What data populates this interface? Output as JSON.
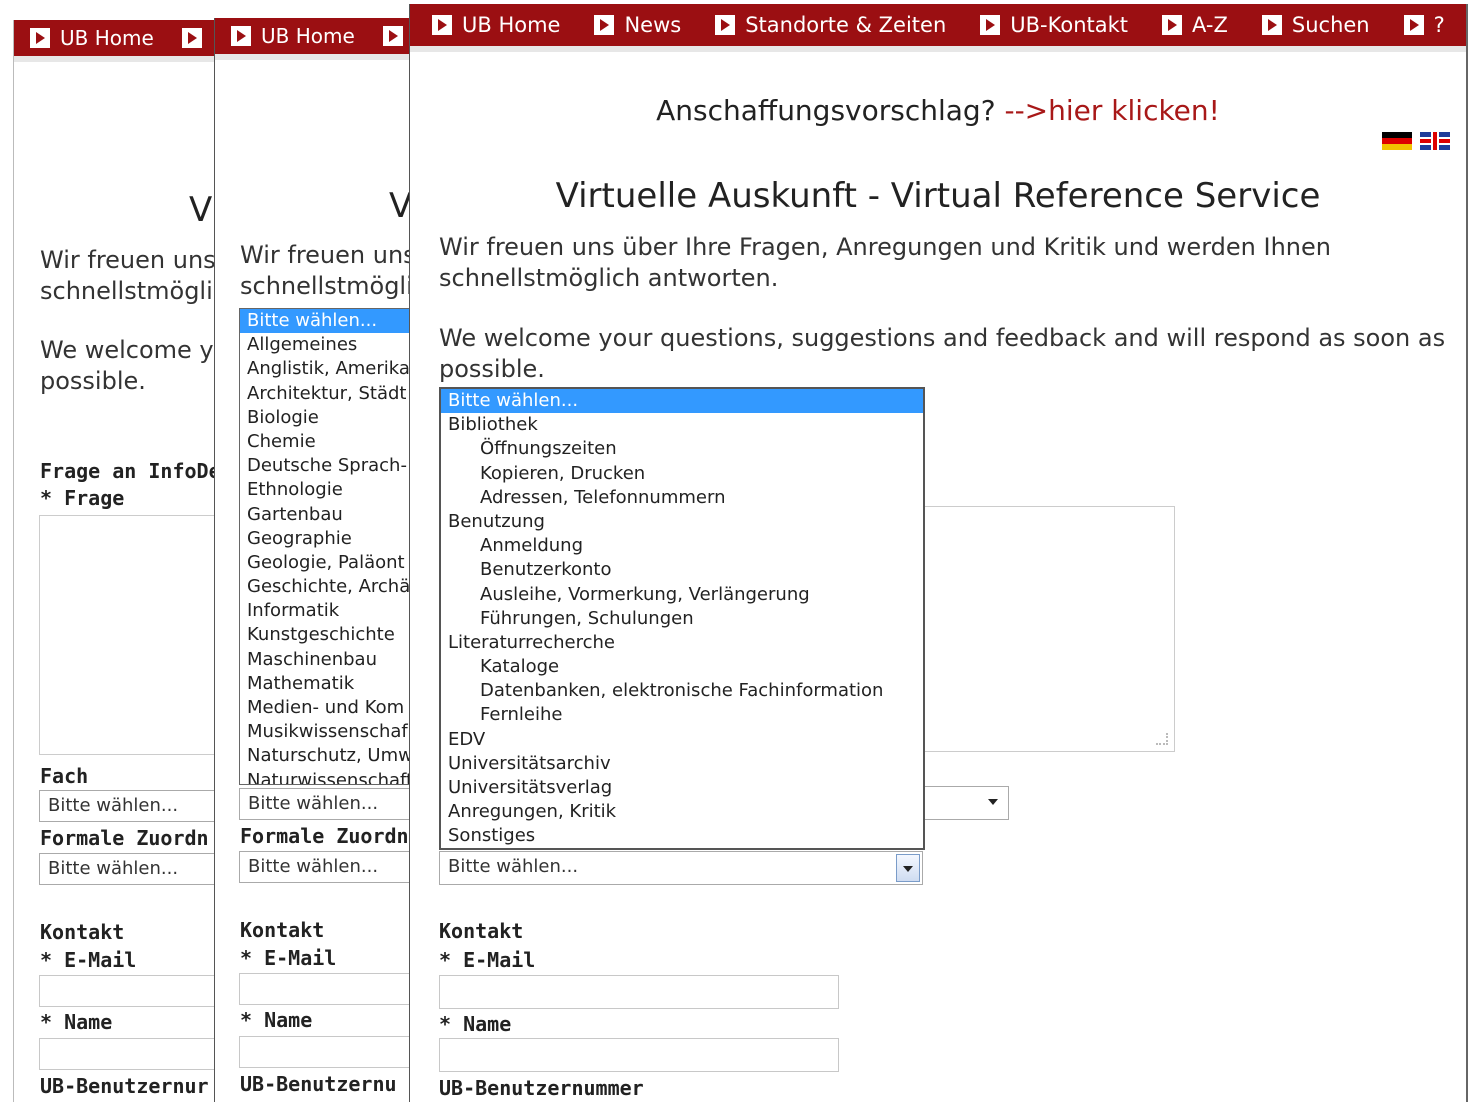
{
  "nav": {
    "home": "UB Home",
    "news": "News",
    "locations": "Standorte & Zeiten",
    "contact": "UB-Kontakt",
    "az": "A-Z",
    "search": "Suchen",
    "help": "?"
  },
  "suggestion": {
    "text": "Anschaffungsvorschlag? ",
    "link": "-->hier klicken!"
  },
  "flags": [
    "flag-de-icon",
    "flag-uk-icon"
  ],
  "page": {
    "title": "Virtuelle Auskunft - Virtual Reference Service",
    "title_cut1": "Vi",
    "title_cut2": "V",
    "intro_de_1": "Wir freuen uns über Ihre Fragen, Anregungen und Kritik und werden Ihnen",
    "intro_de_2": "schnellstmöglich antworten.",
    "intro_en_1": "We welcome your questions, suggestions and feedback and will respond as soon as",
    "intro_en_2": "possible.",
    "w1_intro_de_1": "Wir freuen uns",
    "w1_intro_de_2": "schnellstmöglic",
    "w1_intro_en_1": "We welcome yo",
    "w1_intro_en_2": "possible.",
    "w2_intro_de_1": "Wir freuen uns",
    "w2_intro_de_2": "schnellstmöglic"
  },
  "form": {
    "section_question": "Frage an InfoDe",
    "question_label": "* Frage",
    "subject_label": "Fach",
    "subject_cut": "Fach",
    "formal_label_cut1": "Formale Zuordn",
    "formal_label_cut2": "Formale Zuordn",
    "select_default": "Bitte wählen...",
    "contact": "Kontakt",
    "email": "* E-Mail",
    "name": "* Name",
    "user_number": "UB-Benutzernummer",
    "user_number_cut1": "UB-Benutzernur",
    "user_number_cut2": "UB-Benutzernu"
  },
  "subject_options": [
    "Bitte wählen...",
    "Allgemeines",
    "Anglistik, Amerika",
    "Architektur, Städt",
    "Biologie",
    "Chemie",
    "Deutsche Sprach-",
    "Ethnologie",
    "Gartenbau",
    "Geographie",
    "Geologie, Paläont",
    "Geschichte, Archä",
    "Informatik",
    "Kunstgeschichte",
    "Maschinenbau",
    "Mathematik",
    "Medien- und Kom",
    "Musikwissenschaf",
    "Naturschutz, Umw",
    "Naturwissenschaft"
  ],
  "category_options": [
    {
      "label": "Bitte wählen...",
      "indent": false
    },
    {
      "label": "Bibliothek",
      "indent": false
    },
    {
      "label": "Öffnungszeiten",
      "indent": true
    },
    {
      "label": "Kopieren, Drucken",
      "indent": true
    },
    {
      "label": "Adressen, Telefonnummern",
      "indent": true
    },
    {
      "label": "Benutzung",
      "indent": false
    },
    {
      "label": "Anmeldung",
      "indent": true
    },
    {
      "label": "Benutzerkonto",
      "indent": true
    },
    {
      "label": "Ausleihe, Vormerkung, Verlängerung",
      "indent": true
    },
    {
      "label": "Führungen, Schulungen",
      "indent": true
    },
    {
      "label": "Literaturrecherche",
      "indent": false
    },
    {
      "label": "Kataloge",
      "indent": true
    },
    {
      "label": "Datenbanken, elektronische Fachinformation",
      "indent": true
    },
    {
      "label": "Fernleihe",
      "indent": true
    },
    {
      "label": "EDV",
      "indent": false
    },
    {
      "label": "Universitätsarchiv",
      "indent": false
    },
    {
      "label": "Universitätsverlag",
      "indent": false
    },
    {
      "label": "Anregungen, Kritik",
      "indent": false
    },
    {
      "label": "Sonstiges",
      "indent": false
    }
  ],
  "colors": {
    "nav_bg": "#9b0f12",
    "link": "#a81818",
    "selection": "#3399ff"
  }
}
